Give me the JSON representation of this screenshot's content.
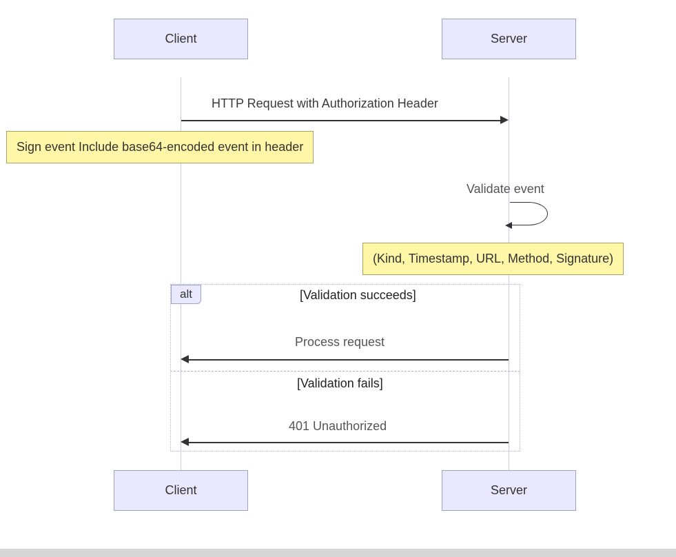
{
  "chart_data": {
    "type": "sequence-diagram",
    "actors": [
      "Client",
      "Server"
    ],
    "messages": [
      {
        "from": "Client",
        "to": "Server",
        "label": "HTTP Request with Authorization Header",
        "note_left_of_from": "Sign event Include base64-encoded event in header"
      },
      {
        "from": "Server",
        "to": "Server",
        "label": "Validate event",
        "note_right_of_to": "(Kind, Timestamp, URL, Method, Signature)"
      }
    ],
    "alt": {
      "label": "alt",
      "branches": [
        {
          "condition": "[Validation succeeds]",
          "messages": [
            {
              "from": "Server",
              "to": "Client",
              "label": "Process request"
            }
          ]
        },
        {
          "condition": "[Validation fails]",
          "messages": [
            {
              "from": "Server",
              "to": "Client",
              "label": "401 Unauthorized"
            }
          ]
        }
      ]
    }
  },
  "actors": {
    "client": "Client",
    "server": "Server"
  },
  "messages": {
    "http_request": "HTTP Request with Authorization Header",
    "validate_event": "Validate event",
    "process_request": "Process request",
    "unauthorized": "401 Unauthorized"
  },
  "notes": {
    "sign_event": "Sign event Include base64-encoded event in header",
    "validation_items": "(Kind, Timestamp, URL, Method, Signature)"
  },
  "alt": {
    "label": "alt",
    "cond_success": "[Validation succeeds]",
    "cond_fail": "[Validation fails]"
  }
}
